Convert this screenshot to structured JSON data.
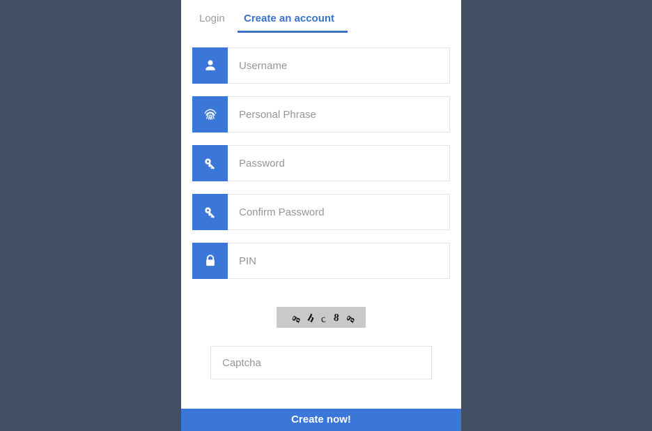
{
  "theme": {
    "page_background": "#434f63",
    "card_background": "#ffffff",
    "accent_blue": "#3a77d8",
    "tab_active_blue": "#3a72cc",
    "tab_inactive_gray": "#9a9a9a",
    "placeholder_gray": "#969696",
    "input_border": "#e2e2e2",
    "captcha_background": "#c9c9c9"
  },
  "tabs": [
    {
      "id": "login",
      "label": "Login",
      "active": false
    },
    {
      "id": "create-account",
      "label": "Create an account",
      "active": true
    }
  ],
  "form": {
    "fields": [
      {
        "id": "username",
        "placeholder": "Username",
        "value": "",
        "icon": "user-icon"
      },
      {
        "id": "personal-phrase",
        "placeholder": "Personal Phrase",
        "value": "",
        "icon": "fingerprint-icon"
      },
      {
        "id": "password",
        "placeholder": "Password",
        "value": "",
        "icon": "key-icon"
      },
      {
        "id": "confirm-password",
        "placeholder": "Confirm Password",
        "value": "",
        "icon": "key-icon"
      },
      {
        "id": "pin",
        "placeholder": "PIN",
        "value": "",
        "icon": "lock-icon"
      }
    ]
  },
  "captcha": {
    "image_alt": "captcha-image",
    "characters": [
      "g",
      "h",
      "c",
      "8",
      "g"
    ],
    "input": {
      "placeholder": "Captcha",
      "value": ""
    }
  },
  "submit": {
    "label": "Create now!"
  }
}
